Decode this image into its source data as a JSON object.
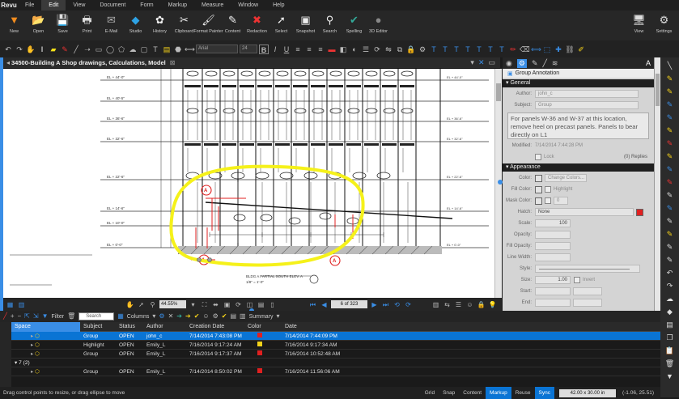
{
  "logo": "Revu",
  "menu": [
    "File",
    "Edit",
    "View",
    "Document",
    "Form",
    "Markup",
    "Measure",
    "Window",
    "Help"
  ],
  "menu_active": "Edit",
  "ribbon": [
    {
      "icon": "new-icon",
      "glyph": "▼",
      "label": "New",
      "color": "#f28c1e"
    },
    {
      "icon": "open-icon",
      "glyph": "📂",
      "label": "Open",
      "color": "#e8c04a"
    },
    {
      "icon": "save-icon",
      "glyph": "💾",
      "label": "Save",
      "color": "#ddd"
    },
    {
      "icon": "print-icon",
      "glyph": "🖶",
      "label": "Print",
      "color": "#ddd"
    },
    {
      "icon": "email-icon",
      "glyph": "✉",
      "label": "E-Mail",
      "color": "#aaa"
    },
    {
      "icon": "studio-icon",
      "glyph": "◆",
      "label": "Studio",
      "color": "#2ea3e6"
    },
    {
      "icon": "history-icon",
      "glyph": "✿",
      "label": "History",
      "color": "#eee"
    },
    {
      "icon": "clipboard-icon",
      "glyph": "✂",
      "label": "Clipboard",
      "color": "#eee"
    },
    {
      "icon": "format-painter-icon",
      "glyph": "🖌",
      "label": "Format Painter",
      "color": "#eee"
    },
    {
      "icon": "content-icon",
      "glyph": "✎",
      "label": "Content",
      "color": "#eee"
    },
    {
      "icon": "redaction-icon",
      "glyph": "✖",
      "label": "Redaction",
      "color": "#e33"
    },
    {
      "icon": "select-icon",
      "glyph": "➚",
      "label": "Select",
      "color": "#eee"
    },
    {
      "icon": "snapshot-icon",
      "glyph": "▣",
      "label": "Snapshot",
      "color": "#eee"
    },
    {
      "icon": "search-icon",
      "glyph": "⚲",
      "label": "Search",
      "color": "#eee"
    },
    {
      "icon": "spelling-icon",
      "glyph": "✔",
      "label": "Spelling",
      "color": "#3a9"
    },
    {
      "icon": "3d-editor-icon",
      "glyph": "●",
      "label": "3D Editor",
      "color": "#888"
    }
  ],
  "ribbon_right": [
    {
      "icon": "view-icon",
      "glyph": "🖥",
      "label": "View"
    },
    {
      "icon": "settings-icon",
      "glyph": "⚙",
      "label": "Settings"
    }
  ],
  "format_bar": {
    "font": "Arial",
    "size": "24"
  },
  "document": {
    "title": "34500-Building A Shop drawings, Calculations, Model"
  },
  "drawing": {
    "elevations": [
      "EL + 44'-0\"",
      "EL + 40'-5\"",
      "EL + 36'-6\"",
      "EL + 32'-6\"",
      "EL + 22'-6\"",
      "EL + 14'-6\"",
      "EL + 10'-0\"",
      "EL + 0'-0\""
    ],
    "caption": "BLDG A PARTIAL SOUTH ELEV. A",
    "scale": "1/8\" = 1'-0\""
  },
  "navbar": {
    "zoom": "44.55%",
    "page": "6 of 323"
  },
  "properties": {
    "header": "Group Annotation",
    "general_label": "General",
    "author_label": "Author:",
    "author": "john_c",
    "subject_label": "Subject:",
    "subject": "Group",
    "comment": "For panels W-36 and W-37 at this location, remove heel on precast panels.  Panels to bear directly on L1",
    "modified_label": "Modified:",
    "modified": "7/14/2014 7:44:28 PM",
    "lock_label": "Lock",
    "replies_label": "(0) Replies",
    "appearance_label": "Appearance",
    "color_label": "Color:",
    "change_colors": "Change Colors...",
    "fill_label": "Fill Color:",
    "highlight_label": "Highlight",
    "mask_label": "Mask Color:",
    "mask_value": "0",
    "hatch_label": "Hatch:",
    "hatch_value": "None",
    "scale_label": "Scale:",
    "scale_value": "100",
    "opacity_label": "Opacity:",
    "fill_opacity_label": "Fill Opacity:",
    "line_width_label": "Line Width:",
    "style_label": "Style:",
    "size_label": "Size:",
    "size_value": "1.00",
    "invert_label": "Invert",
    "start_label": "Start:",
    "end_label": "End:"
  },
  "markups_toolbar": {
    "filter": "Filter",
    "search_placeholder": "Search",
    "columns": "Columns",
    "summary": "Summary"
  },
  "table": {
    "columns": [
      "Space",
      "Subject",
      "Status",
      "Author",
      "Creation Date",
      "Color",
      "Date"
    ],
    "rows": [
      {
        "subject": "Group",
        "status": "OPEN",
        "author": "john_c",
        "created": "7/14/2014 7:43:08 PM",
        "color": "#e02020",
        "date": "7/14/2014 7:44:09 PM",
        "selected": true
      },
      {
        "subject": "Highlight",
        "status": "OPEN",
        "author": "Emily_L",
        "created": "7/16/2014 9:17:24 AM",
        "color": "#f2d21a",
        "date": "7/16/2014 9:17:34 AM",
        "selected": false
      },
      {
        "subject": "Group",
        "status": "OPEN",
        "author": "Emily_L",
        "created": "7/16/2014 9:17:37 AM",
        "color": "#e02020",
        "date": "7/16/2014 10:52:48 AM",
        "selected": false
      }
    ],
    "group_label": "7 (2)",
    "group_rows": [
      {
        "subject": "Group",
        "status": "OPEN",
        "author": "Emily_L",
        "created": "7/14/2014 8:50:02 PM",
        "color": "#e02020",
        "date": "7/16/2014 11:56:06 AM",
        "selected": false
      }
    ]
  },
  "status": {
    "hint": "Drag control points to resize, or drag ellipse to move",
    "toggles": [
      {
        "label": "Grid",
        "on": false
      },
      {
        "label": "Snap",
        "on": false
      },
      {
        "label": "Content",
        "on": false
      },
      {
        "label": "Markup",
        "on": true
      },
      {
        "label": "Reuse",
        "on": false
      },
      {
        "label": "Sync",
        "on": true
      }
    ],
    "dimensions": "42.00 x 30.00 in",
    "coords": "(-1.06, 25.51)"
  },
  "colors": {
    "accent": "#0a74d4",
    "highlight_markup": "#f5f11a",
    "redline": "#e02020"
  }
}
